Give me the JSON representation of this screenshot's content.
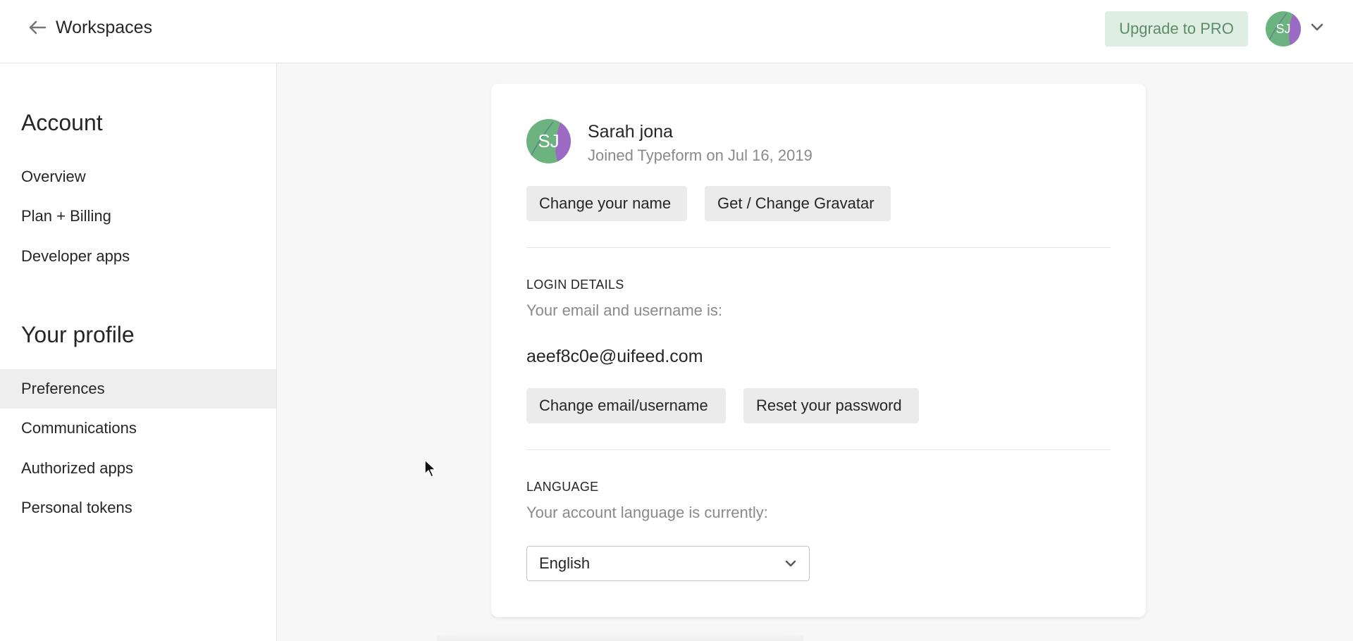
{
  "topbar": {
    "back_icon": "arrow-left-icon",
    "title": "Workspaces",
    "upgrade_label": "Upgrade to PRO",
    "avatar_initials": "SJ",
    "menu_icon": "chevron-down-icon"
  },
  "sidebar": {
    "sections": [
      {
        "heading": "Account",
        "items": [
          {
            "label": "Overview",
            "active": false
          },
          {
            "label": "Plan + Billing",
            "active": false
          },
          {
            "label": "Developer apps",
            "active": false
          }
        ]
      },
      {
        "heading": "Your profile",
        "items": [
          {
            "label": "Preferences",
            "active": true
          },
          {
            "label": "Communications",
            "active": false
          },
          {
            "label": "Authorized apps",
            "active": false
          },
          {
            "label": "Personal tokens",
            "active": false
          }
        ]
      }
    ]
  },
  "profile": {
    "avatar_initials": "SJ",
    "name": "Sarah jona",
    "joined": "Joined Typeform on Jul 16, 2019",
    "change_name_label": "Change your name",
    "gravatar_label": "Get / Change Gravatar"
  },
  "login": {
    "title": "LOGIN DETAILS",
    "description": "Your email and username is:",
    "email": "aeef8c0e@uifeed.com",
    "change_email_label": "Change email/username",
    "reset_password_label": "Reset your password"
  },
  "language": {
    "title": "LANGUAGE",
    "description": "Your account language is currently:",
    "selected": "English",
    "dropdown_icon": "chevron-down-icon"
  },
  "colors": {
    "avatar_green": "#6db37f",
    "avatar_purple": "#9b6bc4",
    "upgrade_bg": "#dfeee2",
    "upgrade_text": "#5e8a69",
    "active_item_bg": "#eeeeee",
    "page_bg": "#f7f7f7"
  }
}
